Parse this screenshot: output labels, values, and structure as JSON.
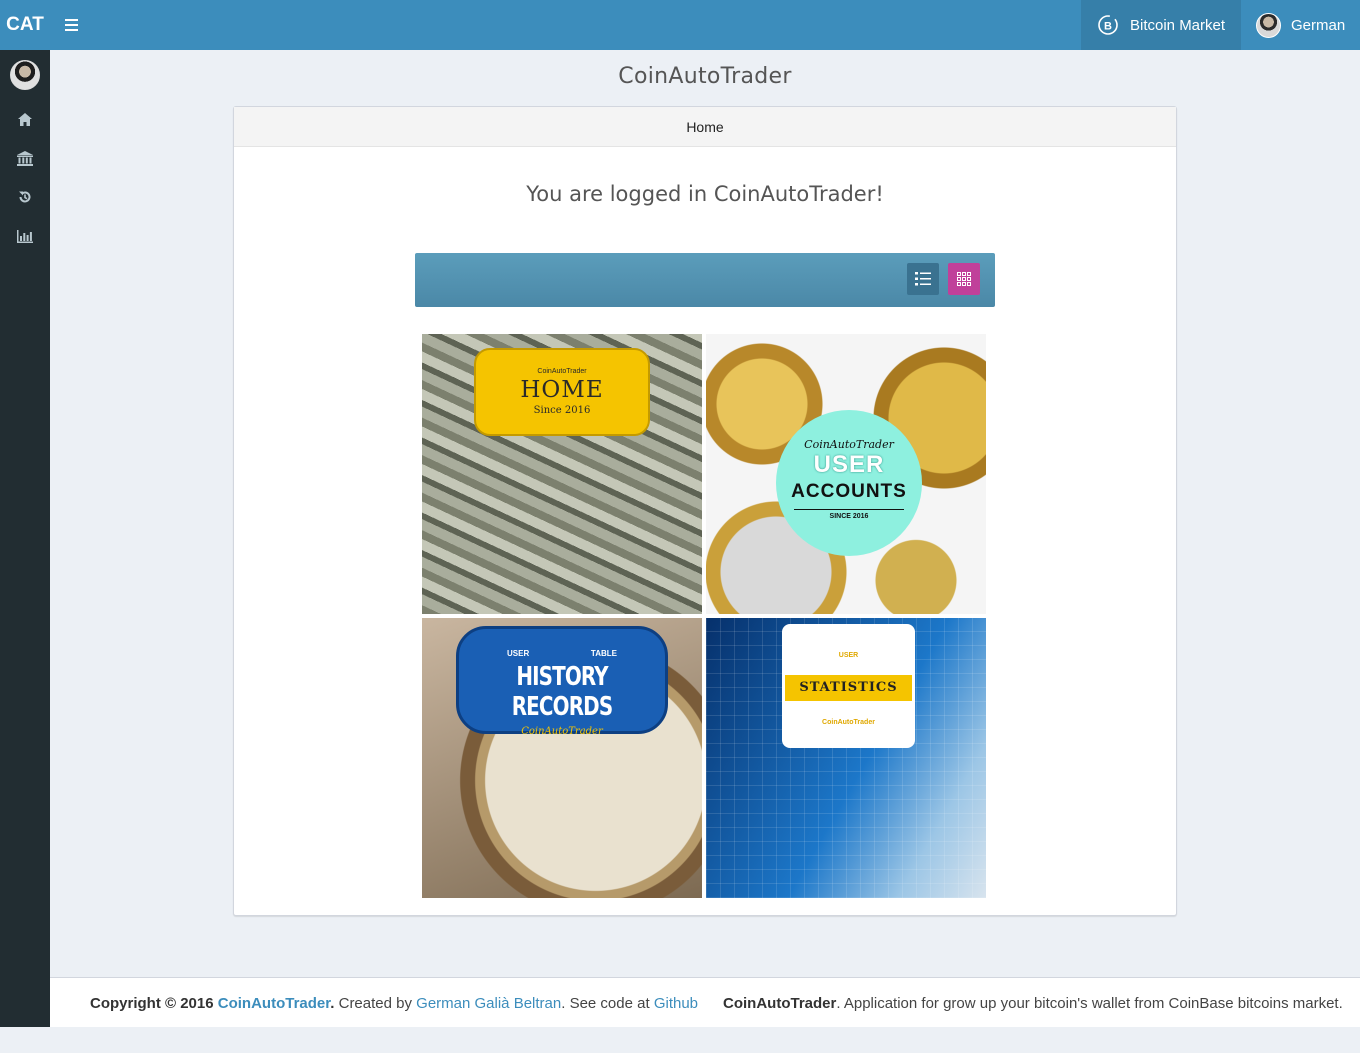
{
  "header": {
    "logo": "CAT",
    "menu_icon": "bars-icon",
    "market_label": "Bitcoin Market",
    "market_icon": "bitcoin-exchange-icon",
    "user_name": "German"
  },
  "sidebar": {
    "items": [
      {
        "icon": "home-icon"
      },
      {
        "icon": "bank-icon"
      },
      {
        "icon": "history-icon"
      },
      {
        "icon": "bar-chart-icon"
      }
    ]
  },
  "main": {
    "app_title": "CoinAutoTrader",
    "breadcrumb": "Home",
    "welcome": "You are logged in CoinAutoTrader!"
  },
  "gallery": {
    "view_modes": [
      "list-view-icon",
      "grid-view-icon"
    ],
    "tiles": [
      {
        "brand": "CoinAutoTrader",
        "title": "HOME",
        "subtitle": "Since 2016"
      },
      {
        "brand": "CoinAutoTrader",
        "title_line1": "USER",
        "title_line2": "ACCOUNTS",
        "subtitle": "SINCE 2016"
      },
      {
        "tag_left": "USER",
        "tag_right": "TABLE",
        "title": "HISTORY RECORDS",
        "brand": "CoinAutoTrader"
      },
      {
        "tag": "USER",
        "title": "STATISTICS",
        "brand": "CoinAutoTrader"
      }
    ]
  },
  "footer": {
    "copyright_prefix": "Copyright © 2016 ",
    "brand": "CoinAutoTrader",
    "dot": ".",
    "created_by": " Created by ",
    "author": "German Galià Beltran",
    "see_code": ". See code at ",
    "github": "Github",
    "right_brand": "CoinAutoTrader",
    "right_text": ". Application for grow up your bitcoin's wallet from CoinBase bitcoins market."
  },
  "colors": {
    "header": "#3c8dbc",
    "sidebar": "#222d32",
    "background": "#ecf0f5",
    "grid_button": "#c0409a",
    "link": "#3c8dbc"
  }
}
